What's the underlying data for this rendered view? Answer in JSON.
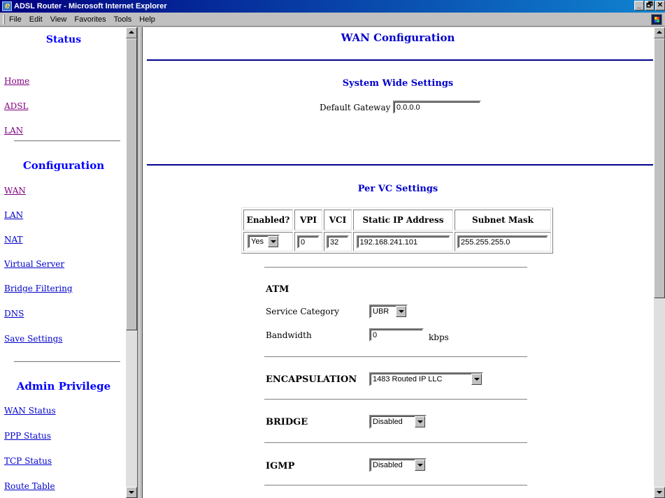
{
  "window": {
    "title": "ADSL Router - Microsoft Internet Explorer",
    "controls": [
      "_",
      "🗗",
      "✕"
    ]
  },
  "menu": [
    "File",
    "Edit",
    "View",
    "Favorites",
    "Tools",
    "Help"
  ],
  "nav": {
    "status_heading": "Status",
    "status_links": [
      "Home",
      "ADSL",
      "LAN"
    ],
    "config_heading": "Configuration",
    "config_links": [
      "WAN",
      "LAN",
      "NAT",
      "Virtual Server",
      "Bridge Filtering",
      "DNS",
      "Save Settings"
    ],
    "admin_heading": "Admin Privilege",
    "admin_links": [
      "WAN Status",
      "PPP Status",
      "TCP Status",
      "Route Table"
    ]
  },
  "main": {
    "title": "WAN Configuration",
    "system_heading": "System Wide Settings",
    "default_gateway_label": "Default Gateway",
    "default_gateway_value": "0.0.0.0",
    "per_vc_heading": "Per VC Settings",
    "vc_table": {
      "headers": [
        "Enabled?",
        "VPI",
        "VCI",
        "Static IP Address",
        "Subnet Mask"
      ],
      "row": {
        "enabled": "Yes",
        "vpi": "0",
        "vci": "32",
        "ip": "192.168.241.101",
        "mask": "255.255.255.0"
      }
    },
    "atm_heading": "ATM",
    "service_category_label": "Service Category",
    "service_category_value": "UBR",
    "bandwidth_label": "Bandwidth",
    "bandwidth_value": "0",
    "bandwidth_unit": "kbps",
    "encapsulation_label": "ENCAPSULATION",
    "encapsulation_value": "1483 Routed IP LLC",
    "bridge_label": "BRIDGE",
    "bridge_value": "Disabled",
    "igmp_label": "IGMP",
    "igmp_value": "Disabled"
  },
  "colors": {
    "link_visited": "#800080",
    "link": "#0000cc",
    "heading": "#0000ff",
    "rule": "#00008b",
    "titlebar": "#000080"
  }
}
